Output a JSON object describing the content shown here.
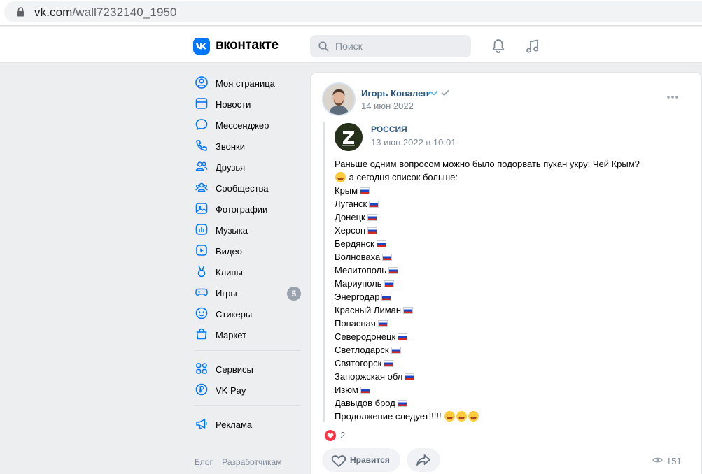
{
  "browser": {
    "url_host": "vk.com",
    "url_path": "/wall7232140_1950"
  },
  "header": {
    "logo_text": "вконтакте",
    "search_placeholder": "Поиск"
  },
  "sidebar": {
    "items": [
      {
        "label": "Моя страница",
        "icon": "user-circle-icon"
      },
      {
        "label": "Новости",
        "icon": "news-icon"
      },
      {
        "label": "Мессенджер",
        "icon": "message-icon"
      },
      {
        "label": "Звонки",
        "icon": "phone-icon"
      },
      {
        "label": "Друзья",
        "icon": "friends-icon"
      },
      {
        "label": "Сообщества",
        "icon": "communities-icon"
      },
      {
        "label": "Фотографии",
        "icon": "photo-icon"
      },
      {
        "label": "Музыка",
        "icon": "music-icon"
      },
      {
        "label": "Видео",
        "icon": "video-icon"
      },
      {
        "label": "Клипы",
        "icon": "clips-icon"
      },
      {
        "label": "Игры",
        "icon": "gamepad-icon",
        "badge": "5"
      },
      {
        "label": "Стикеры",
        "icon": "smile-icon"
      },
      {
        "label": "Маркет",
        "icon": "bag-icon"
      },
      {
        "label": "Сервисы",
        "icon": "services-icon"
      },
      {
        "label": "VK Pay",
        "icon": "ruble-icon"
      },
      {
        "label": "Реклама",
        "icon": "megaphone-icon"
      }
    ],
    "footer_links": [
      "Блог",
      "Разработчикам"
    ]
  },
  "post": {
    "author": "Игорь Ковалев",
    "author_date": "14 июн 2022",
    "repost": {
      "group_name": "РОССИЯ",
      "group_date": "13 июн 2022 в 10:01",
      "lines": [
        "Раньше одним вопросом можно было подорвать пукан укру: Чей Крым?",
        "а сегодня список больше:",
        "Крым",
        "Луганск",
        "Донецк",
        "Херсон",
        "Бердянск",
        "Волноваха",
        "Мелитополь",
        "Мариуполь",
        "Энергодар",
        "Красный Лиман",
        "Попасная",
        "Северодонецк",
        "Светлодарск",
        "Святогорск",
        "Запоржская обл",
        "Изюм",
        "Давыдов брод",
        "Продолжение следует!!!!!"
      ]
    },
    "likes": "2",
    "like_button": "Нравится",
    "views": "151"
  },
  "colors": {
    "accent": "#0077ff",
    "link": "#2a5885",
    "background": "#edeef0",
    "like_red": "#ff3347"
  }
}
